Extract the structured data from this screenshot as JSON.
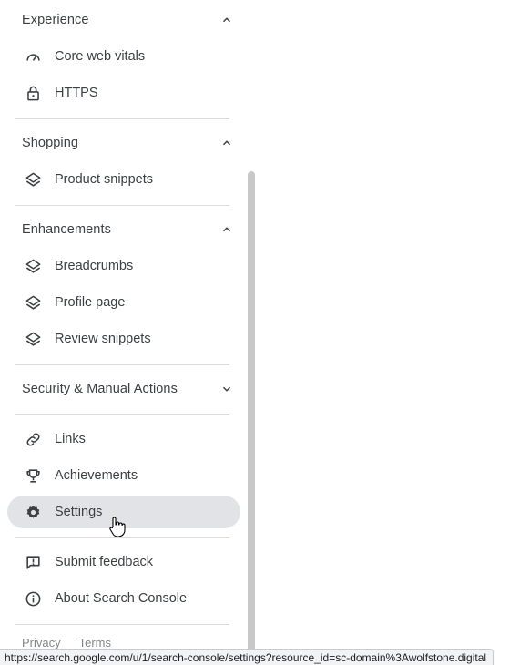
{
  "sections": {
    "experience": {
      "title": "Experience",
      "items": [
        "Core web vitals",
        "HTTPS"
      ]
    },
    "shopping": {
      "title": "Shopping",
      "items": [
        "Product snippets"
      ]
    },
    "enhancements": {
      "title": "Enhancements",
      "items": [
        "Breadcrumbs",
        "Profile page",
        "Review snippets"
      ]
    },
    "security": {
      "title": "Security & Manual Actions"
    }
  },
  "links": [
    "Links",
    "Achievements",
    "Settings"
  ],
  "support": [
    "Submit feedback",
    "About Search Console"
  ],
  "footer": {
    "privacy": "Privacy",
    "terms": "Terms"
  },
  "status_url": "https://search.google.com/u/1/search-console/settings?resource_id=sc-domain%3Awolfstone.digital",
  "icons": {
    "core_web_vitals": "gauge-icon",
    "https": "lock-icon",
    "product_snippets": "layers-icon",
    "links": "link-icon",
    "achievements": "trophy-icon",
    "settings": "gear-icon",
    "submit_feedback": "feedback-icon",
    "about": "info-icon"
  },
  "colors": {
    "active_bg": "#e1e3e6",
    "text": "#3c4043",
    "divider": "#dadce0"
  }
}
